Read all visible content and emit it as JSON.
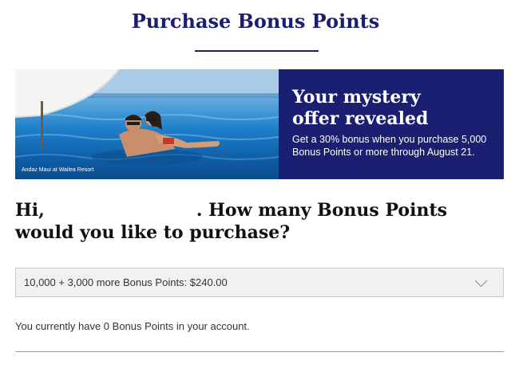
{
  "page": {
    "title": "Purchase Bonus Points"
  },
  "banner": {
    "photo_caption": "Andaz Maui at Wailea Resort",
    "offer_title_line1": "Your mystery",
    "offer_title_line2": "offer revealed",
    "offer_description": "Get a 30% bonus when you purchase 5,000 Bonus Points or more through August 21.",
    "colors": {
      "offer_background": "#1a1f71",
      "title_color": "#1a1f71"
    }
  },
  "greeting": {
    "prefix": "Hi,",
    "question": ". How many Bonus Points would you like to purchase?"
  },
  "points_select": {
    "selected": "10,000 + 3,000 more Bonus Points: $240.00",
    "icon": "chevron-down-icon"
  },
  "account": {
    "balance_text": "You currently have 0 Bonus Points in your account."
  }
}
